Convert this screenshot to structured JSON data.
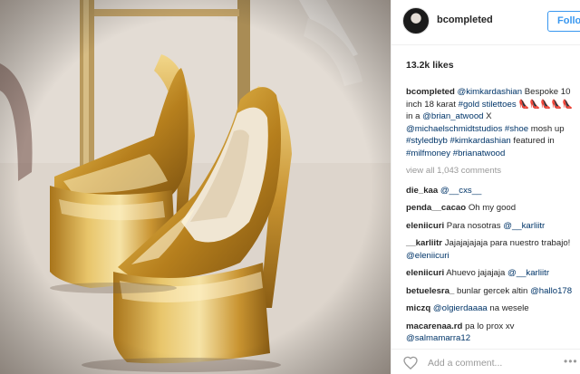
{
  "post": {
    "username": "bcompleted",
    "follow_label": "Follow",
    "likes": "13.2k likes",
    "caption": {
      "user": "bcompleted",
      "parts": [
        {
          "t": "@kimkardashian",
          "link": true
        },
        {
          "t": " Bespoke 10 inch 18 karat ",
          "link": false
        },
        {
          "t": "#gold",
          "link": true
        },
        {
          "t": " ",
          "link": false
        },
        {
          "t": "stilettoes",
          "link": true
        },
        {
          "t": " 👠👠👠👠👠 in a ",
          "link": false
        },
        {
          "t": "@brian_atwood",
          "link": true
        },
        {
          "t": " X ",
          "link": false
        },
        {
          "t": "@michaelschmidtstudios",
          "link": true
        },
        {
          "t": " ",
          "link": false
        },
        {
          "t": "#shoe",
          "link": true
        },
        {
          "t": " mosh up ",
          "link": false
        },
        {
          "t": "#styledbyb",
          "link": true
        },
        {
          "t": " ",
          "link": false
        },
        {
          "t": "#kimkardashian",
          "link": true
        },
        {
          "t": " featured in ",
          "link": false
        },
        {
          "t": "#milfmoney",
          "link": true
        },
        {
          "t": " ",
          "link": false
        },
        {
          "t": "#brianatwood",
          "link": true
        }
      ]
    },
    "view_all": "view all 1,043 comments",
    "comments": [
      {
        "user": "die_kaa",
        "parts": [
          {
            "t": "@__cxs__",
            "link": true
          }
        ]
      },
      {
        "user": "penda__cacao",
        "parts": [
          {
            "t": "Oh my good",
            "link": false
          }
        ]
      },
      {
        "user": "eleniicuri",
        "parts": [
          {
            "t": "Para nosotras ",
            "link": false
          },
          {
            "t": "@__karliitr",
            "link": true
          }
        ]
      },
      {
        "user": "__karliitr",
        "parts": [
          {
            "t": "Jajajajajaja para nuestro trabajo! ",
            "link": false
          },
          {
            "t": "@eleniicuri",
            "link": true
          }
        ]
      },
      {
        "user": "eleniicuri",
        "parts": [
          {
            "t": "Ahuevo jajajaja ",
            "link": false
          },
          {
            "t": "@__karliitr",
            "link": true
          }
        ]
      },
      {
        "user": "betuelesra_",
        "parts": [
          {
            "t": "bunlar gercek altin ",
            "link": false
          },
          {
            "t": "@hallo178",
            "link": true
          }
        ]
      },
      {
        "user": "miczq",
        "parts": [
          {
            "t": "@olgierdaaaa",
            "link": true
          },
          {
            "t": " na wesele",
            "link": false
          }
        ]
      },
      {
        "user": "macarenaa.rd",
        "parts": [
          {
            "t": "pa lo prox xv ",
            "link": false
          },
          {
            "t": "@salmamarra12",
            "link": true
          }
        ]
      }
    ],
    "add_comment_placeholder": "Add a comment...",
    "icons": {
      "heart": "heart-icon",
      "more": "more-options-icon"
    }
  },
  "colors": {
    "link": "#003569",
    "follow_blue": "#3897f0",
    "muted": "#999999",
    "gold": "#d4a93c"
  }
}
